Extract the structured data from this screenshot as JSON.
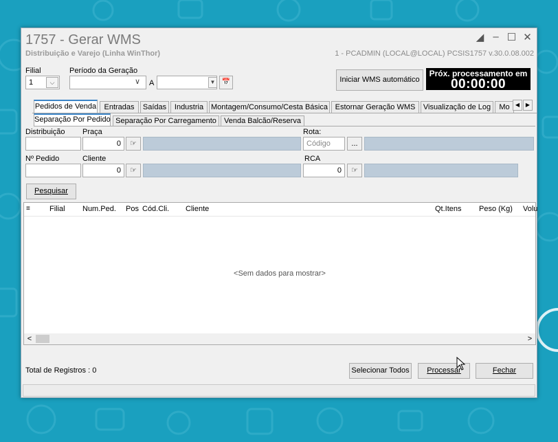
{
  "window": {
    "title": "1757 - Gerar WMS",
    "subtitle": "Distribuição e Varejo (Linha WinThor)",
    "userinfo": "1 - PCADMIN (LOCAL@LOCAL)   PCSIS1757  v.30.0.08.002"
  },
  "filters": {
    "filial_label": "Filial",
    "filial_value": "1",
    "periodo_label": "Período da Geração",
    "periodo_from": "",
    "a_label": "A",
    "periodo_to": ""
  },
  "actions": {
    "iniciar_label": "Iniciar WMS automático"
  },
  "countdown": {
    "label": "Próx. processamento em",
    "time": "00:00:00"
  },
  "tabs": [
    "Pedidos de Venda",
    "Entradas",
    "Saídas",
    "Industria",
    "Montagem/Consumo/Cesta Básica",
    "Estornar Geração WMS",
    "Visualização de Log",
    "Mo"
  ],
  "subtabs": [
    "Separação Por Pedido",
    "Separação Por Carregamento",
    "Venda Balcão/Reserva"
  ],
  "form": {
    "distribuicao_label": "Distribuição",
    "distribuicao_value": "",
    "praca_label": "Praça",
    "praca_value": "0",
    "rota_label": "Rota:",
    "rota_placeholder": "Código",
    "rota_more": "...",
    "npedido_label": "Nº Pedido",
    "npedido_value": "",
    "cliente_label": "Cliente",
    "cliente_value": "0",
    "rca_label": "RCA",
    "rca_value": "0",
    "pesquisar_label": "Pesquisar"
  },
  "grid": {
    "columns": [
      "Filial",
      "Num.Ped.",
      "Pos",
      "Cód.Cli.",
      "Cliente",
      "Qt.Itens",
      "Peso (Kg)",
      "Volu"
    ],
    "empty_text": "<Sem dados para mostrar>"
  },
  "footer": {
    "total_label": "Total de Registros : 0",
    "selecionar_label": "Selecionar Todos",
    "processar_label": "Processar",
    "fechar_label": "Fechar"
  },
  "colors": {
    "desktop": "#1aa0bf",
    "tab_accent": "#3c85c7",
    "disabled_field": "#bccbd9"
  }
}
